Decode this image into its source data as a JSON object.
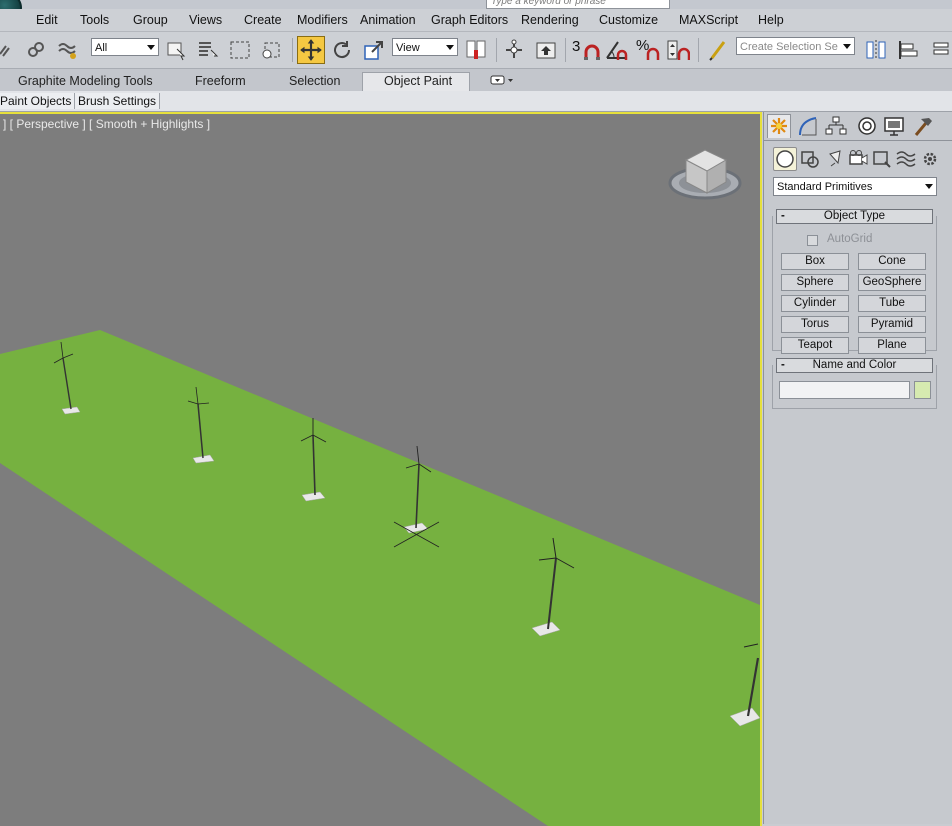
{
  "titlebar": {
    "search_placeholder": "Type a keyword or phrase"
  },
  "menu": {
    "items": [
      "Edit",
      "Tools",
      "Group",
      "Views",
      "Create",
      "Modifiers",
      "Animation",
      "Graph Editors",
      "Rendering",
      "Customize",
      "MAXScript",
      "Help"
    ]
  },
  "toolbar": {
    "selection_filter": "All",
    "reference_coord": "View",
    "snap_label": "3",
    "named_selection_placeholder": "Create Selection Se",
    "icons": [
      "link-icon",
      "unlink-icon",
      "bind-space-warp-icon",
      "select-object-icon",
      "select-by-name-icon",
      "rectangular-selection-icon",
      "window-crossing-icon",
      "select-move-icon",
      "select-rotate-icon",
      "select-scale-icon",
      "pivot-icon",
      "manipulate-icon",
      "snaps-toggle-icon",
      "angle-snap-icon",
      "percent-snap-icon",
      "spinner-snap-icon",
      "edit-named-selections-icon",
      "mirror-icon",
      "align-icon"
    ]
  },
  "ribbon": {
    "tabs": [
      "Graphite Modeling Tools",
      "Freeform",
      "Selection",
      "Object Paint"
    ],
    "active_tab": "Object Paint"
  },
  "subribbon": {
    "tabs": [
      "Paint Objects",
      "Brush Settings"
    ]
  },
  "viewport": {
    "label": "] [ Perspective ] [ Smooth + Highlights ]",
    "colors": {
      "background": "#7d7d7d",
      "ground": "#76b140",
      "active_border": "#e6e03c"
    }
  },
  "command_panel": {
    "tabs": [
      "create-icon",
      "modify-icon",
      "hierarchy-icon",
      "motion-icon",
      "display-icon",
      "utilities-icon"
    ],
    "categories": [
      "geometry-icon",
      "shapes-icon",
      "lights-icon",
      "cameras-icon",
      "helpers-icon",
      "space-warps-icon",
      "systems-icon"
    ],
    "primitive_type": "Standard Primitives",
    "object_type": {
      "title": "Object Type",
      "autogrid_label": "AutoGrid",
      "buttons": [
        "Box",
        "Cone",
        "Sphere",
        "GeoSphere",
        "Cylinder",
        "Tube",
        "Torus",
        "Pyramid",
        "Teapot",
        "Plane"
      ]
    },
    "name_and_color": {
      "title": "Name and Color",
      "name_value": "",
      "color": "#d6eab0"
    }
  }
}
